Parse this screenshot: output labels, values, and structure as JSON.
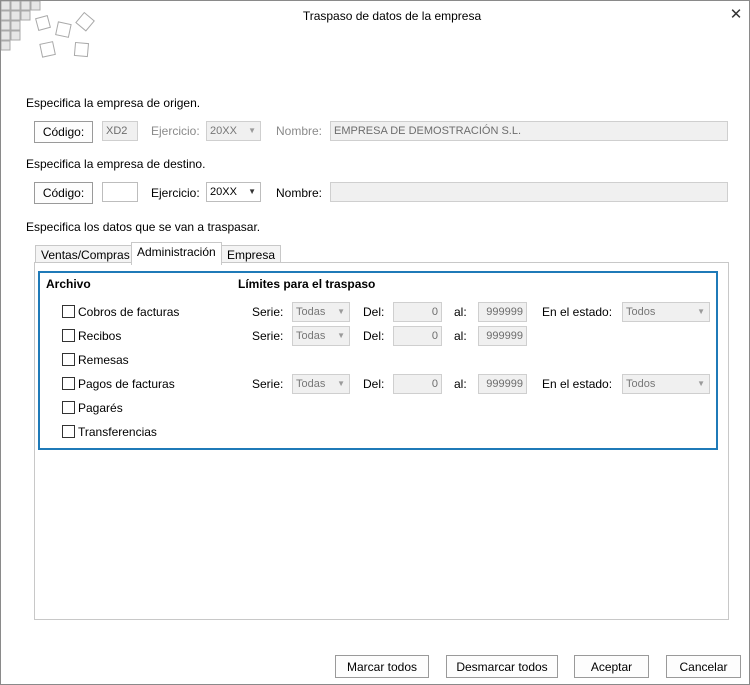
{
  "window": {
    "title": "Traspaso de datos de la empresa",
    "close_glyph": "✕"
  },
  "origen": {
    "heading": "Especifica  la empresa de origen.",
    "codigo_button": "Código:",
    "codigo_value": "XD2",
    "ejercicio_label": "Ejercicio:",
    "ejercicio_value": "20XX",
    "nombre_label": "Nombre:",
    "nombre_value": "EMPRESA DE DEMOSTRACIÓN S.L."
  },
  "destino": {
    "heading": "Especifica la empresa de destino.",
    "codigo_button": "Código:",
    "codigo_value": "",
    "ejercicio_label": "Ejercicio:",
    "ejercicio_value": "20XX",
    "nombre_label": "Nombre:",
    "nombre_value": ""
  },
  "datos_heading": "Especifica los datos que se van a traspasar.",
  "tabs": [
    {
      "label": "Ventas/Compras"
    },
    {
      "label": "Administración"
    },
    {
      "label": "Empresa"
    }
  ],
  "admin": {
    "archivo_header": "Archivo",
    "limites_header": "Límites para el traspaso",
    "rows": [
      {
        "label": "Cobros de facturas",
        "serie_label": "Serie:",
        "serie": "Todas",
        "del_label": "Del:",
        "del": "0",
        "al_label": "al:",
        "al": "999999",
        "estado_label": "En el estado:",
        "estado": "Todos"
      },
      {
        "label": "Recibos",
        "serie_label": "Serie:",
        "serie": "Todas",
        "del_label": "Del:",
        "del": "0",
        "al_label": "al:",
        "al": "999999"
      },
      {
        "label": "Remesas"
      },
      {
        "label": "Pagos de facturas",
        "serie_label": "Serie:",
        "serie": "Todas",
        "del_label": "Del:",
        "del": "0",
        "al_label": "al:",
        "al": "999999",
        "estado_label": "En el estado:",
        "estado": "Todos"
      },
      {
        "label": "Pagarés"
      },
      {
        "label": "Transferencias"
      }
    ]
  },
  "buttons": {
    "marcar": "Marcar todos",
    "desmarcar": "Desmarcar todos",
    "aceptar": "Aceptar",
    "cancelar": "Cancelar"
  },
  "icons": {
    "close": "close-icon",
    "dropdown": "chevron-down-icon",
    "logo": "logo-icon"
  }
}
